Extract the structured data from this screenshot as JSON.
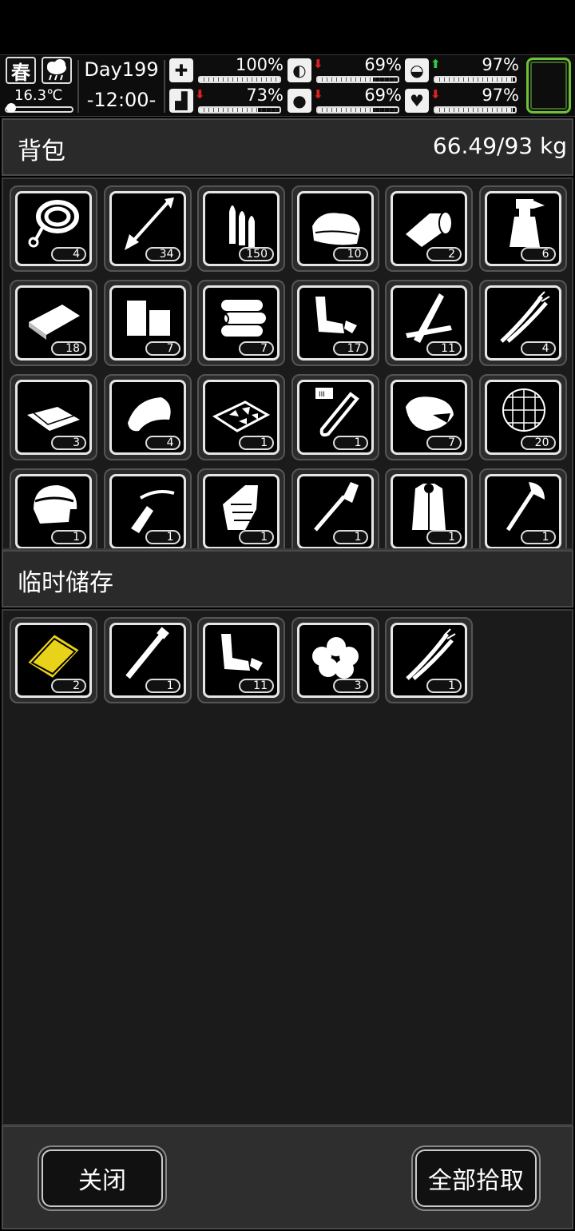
{
  "status": {
    "season": "春",
    "temperature": "16.3℃",
    "day": "Day199",
    "time": "-12:00-",
    "stats": [
      {
        "name": "health",
        "icon": "medkit-icon",
        "glyph": "✚",
        "value": "100%",
        "level": 1.0,
        "trend": ""
      },
      {
        "name": "stamina",
        "icon": "boot-icon",
        "glyph": "▟",
        "value": "73%",
        "level": 0.73,
        "trend": "down"
      },
      {
        "name": "hunger",
        "icon": "stomach-icon",
        "glyph": "◐",
        "value": "69%",
        "level": 0.69,
        "trend": "down"
      },
      {
        "name": "thirst",
        "icon": "water-drop-icon",
        "glyph": "●",
        "value": "69%",
        "level": 0.69,
        "trend": "down"
      },
      {
        "name": "sanity",
        "icon": "brain-icon",
        "glyph": "◒",
        "value": "97%",
        "level": 0.97,
        "trend": "up"
      },
      {
        "name": "mood",
        "icon": "heart-icon",
        "glyph": "♥",
        "value": "97%",
        "level": 0.97,
        "trend": "down"
      }
    ],
    "colors": {
      "up": "#2ecc40",
      "down": "#e02020",
      "equip_slot": "#6ec03b"
    }
  },
  "backpack": {
    "title": "背包",
    "weight": "66.49/93 kg",
    "items": [
      {
        "name": "rope",
        "qty": "4"
      },
      {
        "name": "arrow",
        "qty": "34"
      },
      {
        "name": "bullets",
        "qty": "150"
      },
      {
        "name": "cloth",
        "qty": "10"
      },
      {
        "name": "bandage-roll",
        "qty": "2"
      },
      {
        "name": "spray-bottle",
        "qty": "6"
      },
      {
        "name": "plank",
        "qty": "18"
      },
      {
        "name": "wood-blocks",
        "qty": "7"
      },
      {
        "name": "logs",
        "qty": "7"
      },
      {
        "name": "scrap-parts",
        "qty": "17"
      },
      {
        "name": "boards",
        "qty": "11"
      },
      {
        "name": "fiber",
        "qty": "4"
      },
      {
        "name": "paper",
        "qty": "3"
      },
      {
        "name": "leather",
        "qty": "4"
      },
      {
        "name": "stones-tray",
        "qty": "1"
      },
      {
        "name": "test-tube",
        "qty": "1"
      },
      {
        "name": "meat",
        "qty": "7"
      },
      {
        "name": "net",
        "qty": "20"
      },
      {
        "name": "helmet",
        "qty": "1"
      },
      {
        "name": "crossbow",
        "qty": "1"
      },
      {
        "name": "armor-glove",
        "qty": "1"
      },
      {
        "name": "shovel",
        "qty": "1"
      },
      {
        "name": "fur-coat",
        "qty": "1"
      },
      {
        "name": "axe",
        "qty": "1"
      }
    ]
  },
  "storage": {
    "title": "临时储存",
    "items": [
      {
        "name": "gold-plate",
        "qty": "2",
        "color": "#e8d21a"
      },
      {
        "name": "pipe",
        "qty": "1"
      },
      {
        "name": "scrap-parts",
        "qty": "11"
      },
      {
        "name": "cotton",
        "qty": "3"
      },
      {
        "name": "fiber",
        "qty": "1"
      }
    ]
  },
  "buttons": {
    "close": "关闭",
    "pickup_all": "全部拾取"
  }
}
